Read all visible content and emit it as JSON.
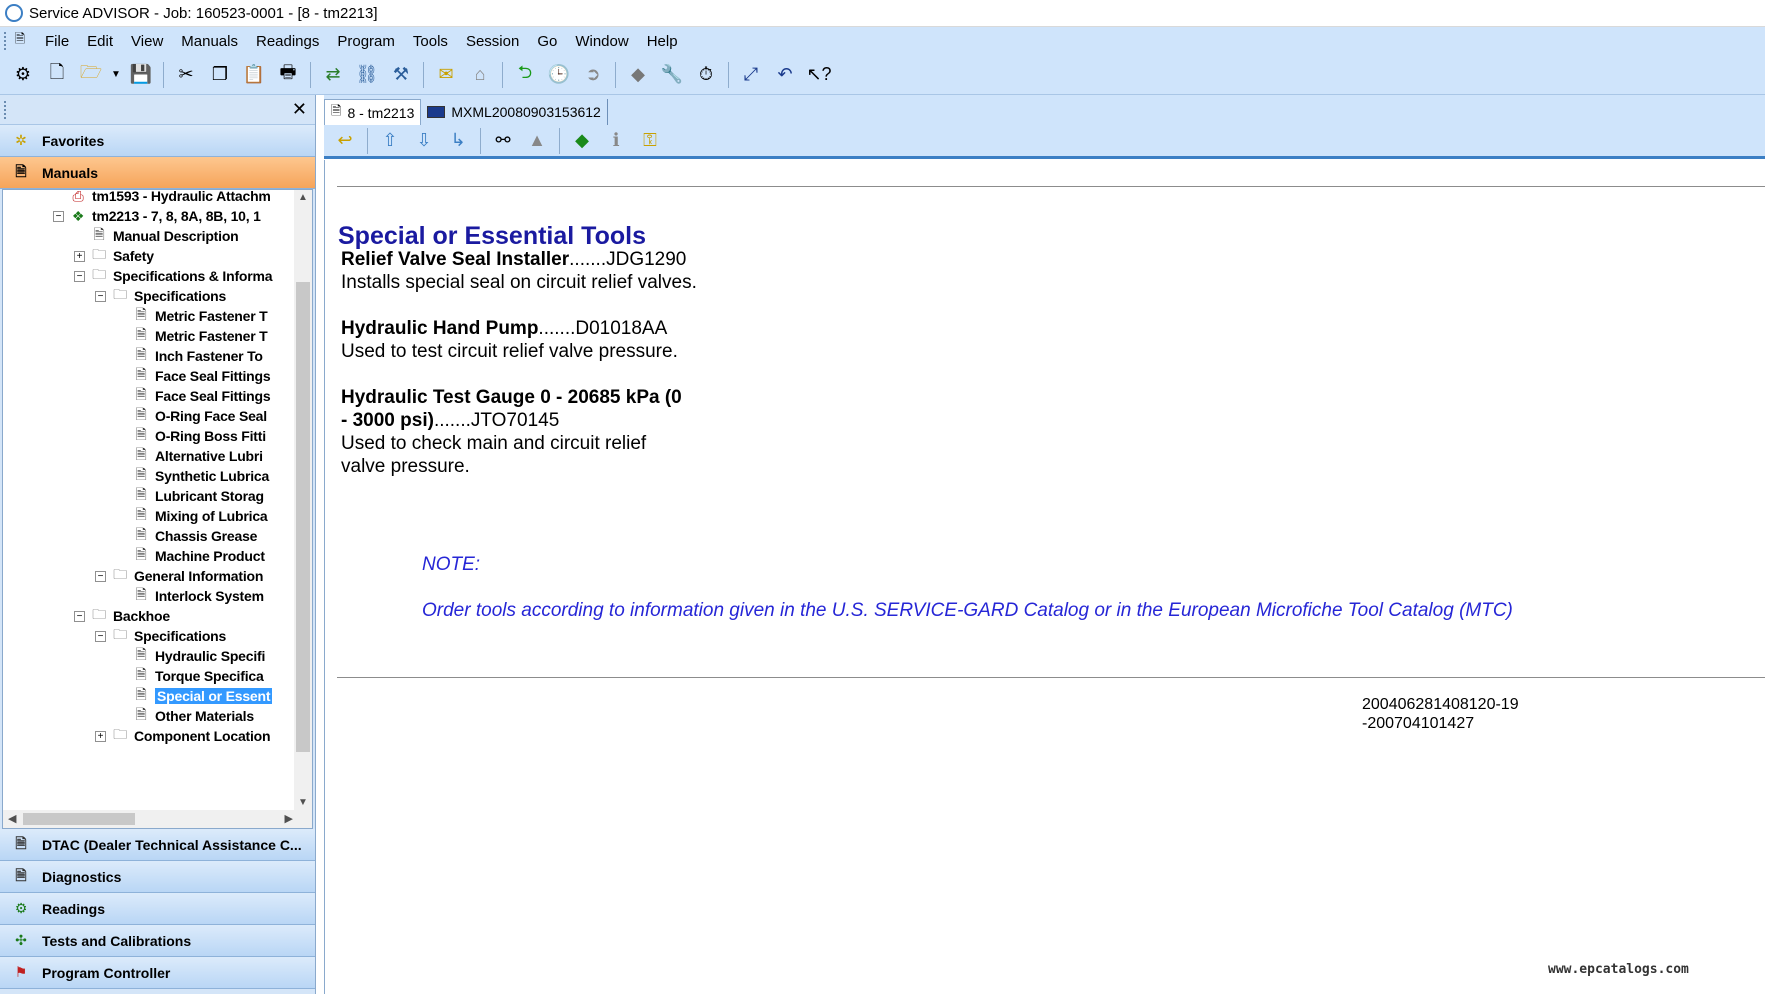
{
  "window": {
    "title": "Service ADVISOR - Job: 160523-0001 - [8 - tm2213]"
  },
  "menu": [
    "File",
    "Edit",
    "View",
    "Manuals",
    "Readings",
    "Program",
    "Tools",
    "Session",
    "Go",
    "Window",
    "Help"
  ],
  "left_panel": {
    "favorites": "Favorites",
    "manuals": "Manuals",
    "tree": [
      {
        "label": "tm1593 - Hydraulic Attachm",
        "indent": 0,
        "icon": "pdf-icon",
        "exp": ""
      },
      {
        "label": "tm2213 - 7, 8, 8A, 8B, 10, 1",
        "indent": 0,
        "icon": "book-icon",
        "exp": "−"
      },
      {
        "label": "Manual Description",
        "indent": 1,
        "icon": "doc-icon",
        "exp": ""
      },
      {
        "label": "Safety",
        "indent": 1,
        "icon": "folder-icon",
        "exp": "+"
      },
      {
        "label": "Specifications & Informa",
        "indent": 1,
        "icon": "folder-icon",
        "exp": "−"
      },
      {
        "label": "Specifications",
        "indent": 2,
        "icon": "folder-icon",
        "exp": "−"
      },
      {
        "label": "Metric Fastener T",
        "indent": 3,
        "icon": "doc-icon",
        "exp": ""
      },
      {
        "label": "Metric Fastener T",
        "indent": 3,
        "icon": "doc-icon",
        "exp": ""
      },
      {
        "label": "Inch Fastener To",
        "indent": 3,
        "icon": "doc-icon",
        "exp": ""
      },
      {
        "label": "Face Seal Fittings",
        "indent": 3,
        "icon": "doc-icon",
        "exp": ""
      },
      {
        "label": "Face Seal Fittings",
        "indent": 3,
        "icon": "doc-icon",
        "exp": ""
      },
      {
        "label": "O-Ring Face Seal",
        "indent": 3,
        "icon": "doc-icon",
        "exp": ""
      },
      {
        "label": "O-Ring Boss Fitti",
        "indent": 3,
        "icon": "doc-icon",
        "exp": ""
      },
      {
        "label": "Alternative Lubri",
        "indent": 3,
        "icon": "doc-icon",
        "exp": ""
      },
      {
        "label": "Synthetic Lubrica",
        "indent": 3,
        "icon": "doc-icon",
        "exp": ""
      },
      {
        "label": "Lubricant Storag",
        "indent": 3,
        "icon": "doc-icon",
        "exp": ""
      },
      {
        "label": "Mixing of Lubrica",
        "indent": 3,
        "icon": "doc-icon",
        "exp": ""
      },
      {
        "label": "Chassis Grease",
        "indent": 3,
        "icon": "doc-icon",
        "exp": ""
      },
      {
        "label": "Machine Product",
        "indent": 3,
        "icon": "doc-icon",
        "exp": ""
      },
      {
        "label": "General Information",
        "indent": 2,
        "icon": "folder-icon",
        "exp": "−"
      },
      {
        "label": "Interlock System",
        "indent": 3,
        "icon": "doc-icon",
        "exp": ""
      },
      {
        "label": "Backhoe",
        "indent": 1,
        "icon": "folder-icon",
        "exp": "−"
      },
      {
        "label": "Specifications",
        "indent": 2,
        "icon": "folder-icon",
        "exp": "−"
      },
      {
        "label": "Hydraulic Specifi",
        "indent": 3,
        "icon": "doc-icon",
        "exp": ""
      },
      {
        "label": "Torque Specifica",
        "indent": 3,
        "icon": "doc-icon",
        "exp": ""
      },
      {
        "label": "Special or Essent",
        "indent": 3,
        "icon": "doc-icon",
        "exp": "",
        "selected": true
      },
      {
        "label": "Other Materials",
        "indent": 3,
        "icon": "doc-icon",
        "exp": ""
      },
      {
        "label": "Component Location",
        "indent": 2,
        "icon": "folder-icon",
        "exp": "+"
      }
    ],
    "bottom_bars": [
      {
        "label": "DTAC (Dealer Technical Assistance C...",
        "icon": "doc-icon"
      },
      {
        "label": "Diagnostics",
        "icon": "doc-icon"
      },
      {
        "label": "Readings",
        "icon": "readings-icon"
      },
      {
        "label": "Tests and Calibrations",
        "icon": "tests-icon"
      },
      {
        "label": "Program Controller",
        "icon": "program-icon"
      }
    ]
  },
  "tabs": [
    {
      "label": "8 - tm2213",
      "active": true
    },
    {
      "label": "MXML20080903153612",
      "active": false
    }
  ],
  "document": {
    "title": "Special or Essential Tools",
    "tools": [
      {
        "name": "Relief Valve Seal Installer",
        "dots": ".......",
        "part": "JDG1290",
        "desc": "Installs special seal on circuit relief valves."
      },
      {
        "name": "Hydraulic Hand Pump",
        "dots": ".......",
        "part": "D01018AA",
        "desc": "Used to test circuit relief valve pressure."
      },
      {
        "name": "Hydraulic Test Gauge 0 - 20685 kPa (0 - 3000 psi)",
        "dots": ".......",
        "part": "JTO70145",
        "desc": "Used to check main and circuit relief valve pressure."
      }
    ],
    "note_label": "NOTE:",
    "note_text": "Order tools according to information given in the U.S. SERVICE-GARD Catalog or in the European Microfiche Tool Catalog (MTC)",
    "doc_id": "200406281408120-19-200704101427"
  },
  "watermark": "www.epcatalogs.com"
}
